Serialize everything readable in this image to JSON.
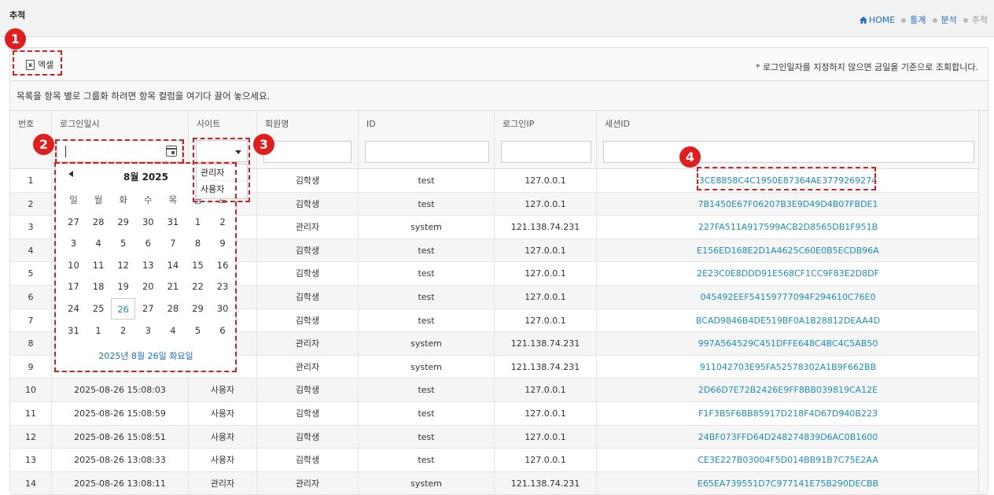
{
  "header": {
    "page_title": "추적",
    "breadcrumb": [
      "HOME",
      "통계",
      "분석",
      "추적"
    ]
  },
  "toolbar": {
    "excel_label": "엑셀",
    "note": "* 로그인일자를 지정하지 않으면 금일을 기준으로 조회합니다."
  },
  "group_hint": "목록을 항목 별로 그룹화 하려면 항목 컬럼을 여기다 끌어 놓으세요.",
  "columns": [
    "번호",
    "로그인일시",
    "사이트",
    "회원명",
    "ID",
    "로그인IP",
    "세션ID"
  ],
  "site_options": [
    "관리자",
    "사용자"
  ],
  "calendar": {
    "title": "8월 2025",
    "weekdays": [
      "일",
      "월",
      "화",
      "수",
      "목",
      "금",
      "토"
    ],
    "weeks": [
      [
        "27",
        "28",
        "29",
        "30",
        "31",
        "1",
        "2"
      ],
      [
        "3",
        "4",
        "5",
        "6",
        "7",
        "8",
        "9"
      ],
      [
        "10",
        "11",
        "12",
        "13",
        "14",
        "15",
        "16"
      ],
      [
        "17",
        "18",
        "19",
        "20",
        "21",
        "22",
        "23"
      ],
      [
        "24",
        "25",
        "26",
        "27",
        "28",
        "29",
        "30"
      ],
      [
        "31",
        "1",
        "2",
        "3",
        "4",
        "5",
        "6"
      ]
    ],
    "selected": "26",
    "footer": "2025년 8월 26일 화요일"
  },
  "rows": [
    {
      "no": "1",
      "dt": "",
      "site": "",
      "name": "김학생",
      "id": "test",
      "ip": "127.0.0.1",
      "sid": "3CE8858C4C1950E87364AE3779269274"
    },
    {
      "no": "2",
      "dt": "",
      "site": "",
      "name": "김학생",
      "id": "test",
      "ip": "127.0.0.1",
      "sid": "7B1450E67F06207B3E9D49D4B07FBDE1"
    },
    {
      "no": "3",
      "dt": "",
      "site": "",
      "name": "관리자",
      "id": "system",
      "ip": "121.138.74.231",
      "sid": "227FA511A917599ACB2D8565DB1F951B"
    },
    {
      "no": "4",
      "dt": "",
      "site": "",
      "name": "김학생",
      "id": "test",
      "ip": "127.0.0.1",
      "sid": "E156ED168E2D1A4625C60E0B5ECDB96A"
    },
    {
      "no": "5",
      "dt": "",
      "site": "",
      "name": "김학생",
      "id": "test",
      "ip": "127.0.0.1",
      "sid": "2E23C0E8DDD91E568CF1CC9F83E2D8DF"
    },
    {
      "no": "6",
      "dt": "",
      "site": "",
      "name": "김학생",
      "id": "test",
      "ip": "127.0.0.1",
      "sid": "045492EEF54159777094F294610C76E0"
    },
    {
      "no": "7",
      "dt": "",
      "site": "",
      "name": "김학생",
      "id": "test",
      "ip": "127.0.0.1",
      "sid": "BCAD9846B4DE519BF0A1B28812DEAA4D"
    },
    {
      "no": "8",
      "dt": "",
      "site": "",
      "name": "관리자",
      "id": "system",
      "ip": "121.138.74.231",
      "sid": "997A564529C451DFFE648C4BC4C5AB50"
    },
    {
      "no": "9",
      "dt": "",
      "site": "",
      "name": "관리자",
      "id": "system",
      "ip": "121.138.74.231",
      "sid": "911042703E95FA52578302A1B9F662BB"
    },
    {
      "no": "10",
      "dt": "2025-08-26 15:08:03",
      "site": "사용자",
      "name": "김학생",
      "id": "test",
      "ip": "127.0.0.1",
      "sid": "2D66D7E72B2426E9FF8BB039819CA12E"
    },
    {
      "no": "11",
      "dt": "2025-08-26 15:08:59",
      "site": "사용자",
      "name": "김학생",
      "id": "test",
      "ip": "127.0.0.1",
      "sid": "F1F3B5F6BB85917D218F4D67D940B223"
    },
    {
      "no": "12",
      "dt": "2025-08-26 15:08:51",
      "site": "사용자",
      "name": "김학생",
      "id": "test",
      "ip": "127.0.0.1",
      "sid": "24BF073FFD64D248274839D6AC0B1600"
    },
    {
      "no": "13",
      "dt": "2025-08-26 13:08:33",
      "site": "사용자",
      "name": "김학생",
      "id": "test",
      "ip": "127.0.0.1",
      "sid": "CE3E227B03004F5D014BB91B7C75E2AA"
    },
    {
      "no": "14",
      "dt": "2025-08-26 13:08:11",
      "site": "관리자",
      "name": "관리자",
      "id": "system",
      "ip": "121.138.74.231",
      "sid": "E65EA739551D7C977141E75B290DECBB"
    }
  ],
  "badges": [
    "1",
    "2",
    "3",
    "4"
  ],
  "colors": {
    "accent": "#1a8fbf",
    "marker": "#e11d1d"
  }
}
